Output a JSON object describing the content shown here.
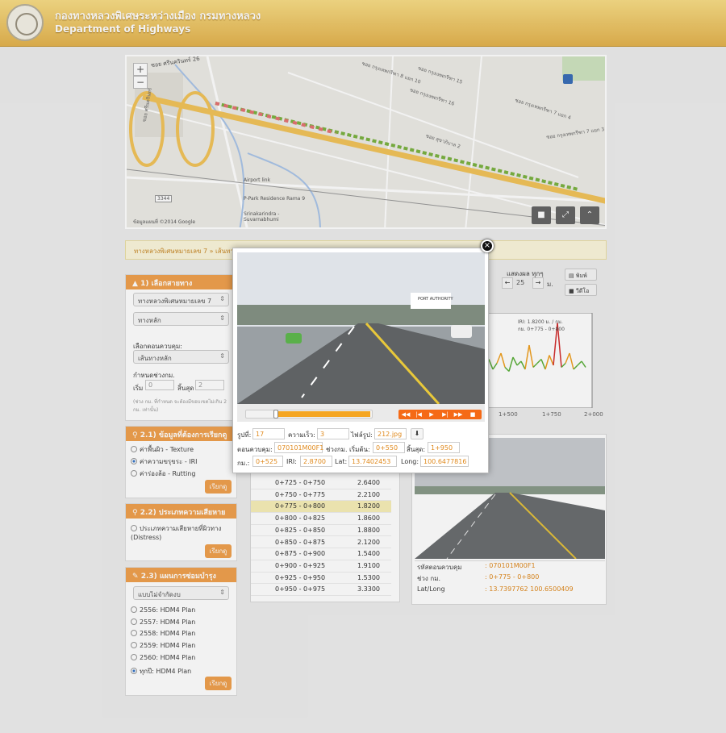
{
  "header": {
    "title": "กองทางหลวงพิเศษระหว่างเมือง กรมทางหลวง",
    "subtitle": "Department of Highways"
  },
  "map": {
    "labels": [
      {
        "text": "ซอย ศรีนครินทร์ 26",
        "cls": "t1"
      },
      {
        "text": "ซอย กรุงเทพกรีฑา 8 แยก 10",
        "cls": "t2"
      },
      {
        "text": "ซอย กรุงเทพกรีฑา 15",
        "cls": "t3"
      },
      {
        "text": "ซอย กรุงเทพกรีฑา 16",
        "cls": "t4"
      },
      {
        "text": "ซอย กรุงเทพกรีฑา 7 แยก 4",
        "cls": "t5"
      },
      {
        "text": "ซอย กรุงเทพกรีฑา 7 แยก 3",
        "cls": "t6"
      },
      {
        "text": "ซอย สุขาภิบาล 2",
        "cls": "t7"
      },
      {
        "text": "ซอย ศรีนครินทร์",
        "cls": "t8"
      },
      {
        "text": "Airport link",
        "cls": "t9"
      },
      {
        "text": "P-Park Residence Rama 9",
        "cls": "t10"
      },
      {
        "text": "Srinakarindra - Suvarnabhumi",
        "cls": "t11"
      },
      {
        "text": "3344",
        "cls": "t12"
      },
      {
        "text": "ข้อมูลแผนที่ ©2014 Google",
        "cls": "t13"
      }
    ],
    "zoom_in": "+",
    "zoom_out": "−"
  },
  "breadcrumb": "ทางหลวงพิเศษหมายเลข 7 » เส้นทางหลัก",
  "sidebar": {
    "s1_title": "1) เลือกสายทาง",
    "route_select": "ทางหลวงพิเศษหมายเลข 7",
    "line_select": "ทางหลัก",
    "control_label": "เลือกตอนควบคุม:",
    "control_select": "เส้นทางหลัก",
    "range_label": "กำหนดช่วงกม.",
    "start_label": "เริ่ม",
    "start_ph": "0",
    "end_label": "สิ้นสุด",
    "end_ph": "2",
    "note": "(ช่วง กม. ที่กำหนด จะต้องมีขอบเขตไม่เกิน 2 กม. เท่านั้น)",
    "s21_title": "2.1) ข้อมูลที่ต้องการเรียกดู",
    "opt_texture": "ค่าพื้นผิว - Texture",
    "opt_iri": "ค่าความขรุขระ - IRI",
    "opt_rut": "ค่าร่องล้อ - Rutting",
    "view_btn": "เรียกดู",
    "s22_title": "2.2) ประเภทความเสียหาย",
    "opt_distress": "ประเภทความเสียหายที่ผิวทาง (Distress)",
    "s23_title": "2.3) แผนการซ่อมบำรุง",
    "budget_select": "แบบไม่จำกัดงบ",
    "plans": [
      "2556: HDM4 Plan",
      "2557: HDM4 Plan",
      "2558: HDM4 Plan",
      "2559: HDM4 Plan",
      "2560: HDM4 Plan",
      "ทุกปี: HDM4 Plan"
    ]
  },
  "controls": {
    "show_label": "แสดงผล ทุกๆ",
    "step_value": "25",
    "unit": "ม.",
    "print_btn": "พิมพ์",
    "video_btn": "วีดีโอ"
  },
  "table_rows": [
    {
      "range": "0+725 - 0+750",
      "iri": "2.6400"
    },
    {
      "range": "0+750 - 0+775",
      "iri": "2.2100"
    },
    {
      "range": "0+775 - 0+800",
      "iri": "1.8200"
    },
    {
      "range": "0+800 - 0+825",
      "iri": "1.8600"
    },
    {
      "range": "0+825 - 0+850",
      "iri": "1.8800"
    },
    {
      "range": "0+850 - 0+875",
      "iri": "2.1200"
    },
    {
      "range": "0+875 - 0+900",
      "iri": "1.5400"
    },
    {
      "range": "0+900 - 0+925",
      "iri": "1.9100"
    },
    {
      "range": "0+925 - 0+950",
      "iri": "1.5300"
    },
    {
      "range": "0+950 - 0+975",
      "iri": "3.3300"
    }
  ],
  "info": {
    "code_label": "รหัสตอนควบคุม",
    "code_value": ": 070101M00F1",
    "range_label": "ช่วง กม.",
    "range_value": ": 0+775 - 0+800",
    "latlong_label": "Lat/Long",
    "latlong_value": ": 13.7397762   100.6500409"
  },
  "chart_data": {
    "type": "line",
    "x": [
      "1+500",
      "1+750",
      "2+000"
    ],
    "annotation_1": "IRI: 1.8200 ม. / กม.",
    "annotation_2": "กม. 0+775 - 0+800",
    "series": [
      {
        "values": [
          2.1,
          1.6,
          1.9,
          2.4,
          1.7,
          1.5,
          2.2,
          1.8,
          2.0,
          1.6,
          2.8,
          1.7,
          1.9,
          2.1,
          1.6,
          2.3,
          1.8,
          3.9,
          1.7,
          1.9,
          2.4,
          1.6,
          1.8,
          2.0,
          1.7
        ]
      }
    ]
  },
  "modal": {
    "image_no_label": "รูปที่:",
    "image_no": "17",
    "speed_label": "ความเร็ว:",
    "speed": "3",
    "file_label": "ไฟล์รูป:",
    "file": "212.jpg",
    "control_label": "ตอนควบคุม:",
    "control": "070101M00F1",
    "start_label": "ช่วงกม. เริ่มต้น:",
    "start": "0+550",
    "end_label": "สิ้นสุด:",
    "end": "1+950",
    "km_label": "กม.:",
    "km": "0+525",
    "iri_label": "IRI:",
    "iri": "2.8700",
    "lat_label": "Lat:",
    "lat": "13.7402453",
    "long_label": "Long:",
    "long": "100.6477816",
    "close": "×",
    "progress": 0.12,
    "sign_text": "PORT AUTHORITY"
  }
}
